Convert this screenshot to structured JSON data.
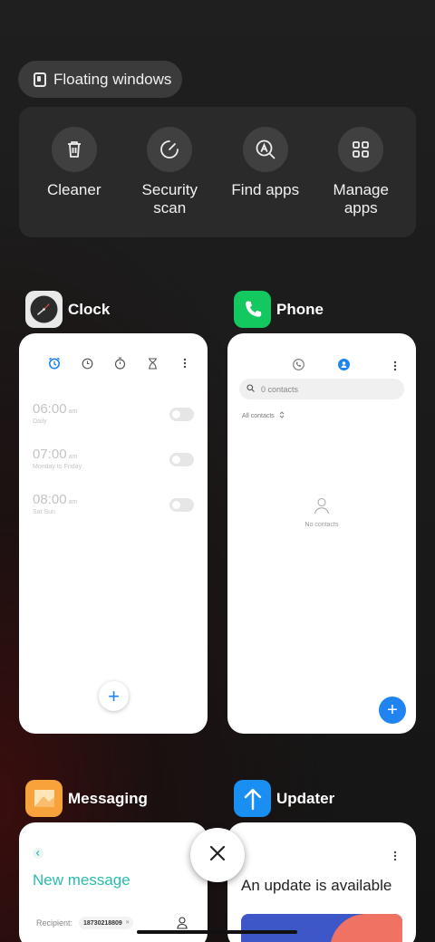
{
  "floating_windows": {
    "label": "Floating windows",
    "icon": "floating-window-icon"
  },
  "quick_actions": [
    {
      "label": "Cleaner",
      "icon": "trash-icon"
    },
    {
      "label": "Security scan",
      "icon": "shield-scan-icon"
    },
    {
      "label": "Find apps",
      "icon": "find-apps-icon"
    },
    {
      "label": "Manage apps",
      "icon": "grid-icon"
    }
  ],
  "apps": {
    "clock": {
      "name": "Clock",
      "alarms": [
        {
          "time": "06:00",
          "ampm": "am",
          "repeat": "Daily"
        },
        {
          "time": "07:00",
          "ampm": "am",
          "repeat": "Monday to Friday"
        },
        {
          "time": "08:00",
          "ampm": "am",
          "repeat": "Sat Sun"
        }
      ],
      "fab": "+"
    },
    "phone": {
      "name": "Phone",
      "search_placeholder": "0 contacts",
      "filter": "All contacts",
      "empty_text": "No contacts",
      "fab": "+"
    },
    "messaging": {
      "name": "Messaging",
      "title": "New message",
      "recipient_label": "Recipient:",
      "recipient_chip": "18730218809"
    },
    "updater": {
      "name": "Updater",
      "title": "An update is available"
    }
  },
  "colors": {
    "accent_blue": "#1f84ef",
    "phone_green": "#12c85f",
    "messaging_orange": "#f7a23b",
    "updater_blue": "#1a8ff2",
    "messaging_teal": "#2bbbad"
  }
}
